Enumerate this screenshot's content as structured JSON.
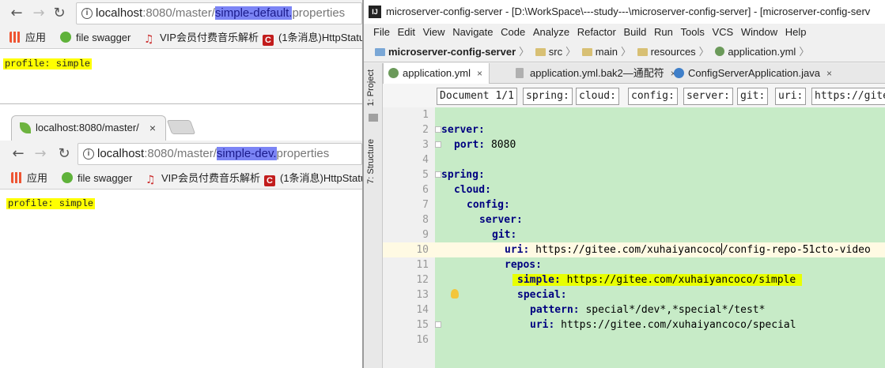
{
  "browser1": {
    "url_host": "localhost",
    "url_port_path": ":8080/master/",
    "url_selected": "simple-default.",
    "url_rest": "properties",
    "bookmarks": [
      "应用",
      "file swagger",
      "VIP会员付费音乐解析",
      "(1条消息)HttpStatu"
    ],
    "content": "profile: simple"
  },
  "browser2": {
    "tab_title": "localhost:8080/master/",
    "tab_close": "×",
    "url_host": "localhost",
    "url_port_path": ":8080/master/",
    "url_selected": "simple-dev.",
    "url_rest": "properties",
    "bookmarks": [
      "应用",
      "file swagger",
      "VIP会员付费音乐解析",
      "(1条消息)HttpStatu"
    ],
    "content": "profile: simple"
  },
  "ide": {
    "title": "microserver-config-server - [D:\\WorkSpace\\---study---\\microserver-config-server] - [microserver-config-serv",
    "menu": [
      "File",
      "Edit",
      "View",
      "Navigate",
      "Code",
      "Analyze",
      "Refactor",
      "Build",
      "Run",
      "Tools",
      "VCS",
      "Window",
      "Help"
    ],
    "breadcrumbs": [
      "microserver-config-server",
      "src",
      "main",
      "resources",
      "application.yml"
    ],
    "side_tabs": [
      "1: Project",
      "7: Structure"
    ],
    "file_tabs": [
      {
        "label": "application.yml",
        "close": "×"
      },
      {
        "label": "application.yml.bak2—通配符",
        "close": "×"
      },
      {
        "label": "ConfigServerApplication.java",
        "close": "×"
      }
    ],
    "yaml_path": [
      "Document 1/1",
      "spring:",
      "cloud:",
      "config:",
      "server:",
      "git:",
      "uri:",
      "https://gite"
    ],
    "lines": [
      "1",
      "2",
      "3",
      "4",
      "5",
      "6",
      "7",
      "8",
      "9",
      "10",
      "11",
      "12",
      "13",
      "14",
      "15",
      "16"
    ],
    "code": {
      "l2": "server:",
      "l3k": "port:",
      "l3v": " 8080",
      "l5": "spring:",
      "l6": "cloud:",
      "l7": "config:",
      "l8": "server:",
      "l9": "git:",
      "l10k": "uri:",
      "l10v1": " https://gitee.com/xuhaiyancoco",
      "l10v2": "/config-repo-51cto-video",
      "l11": "repos:",
      "l12k": "simple:",
      "l12v": " https://gitee.com/xuhaiyancoco/simple ",
      "l13": "special:",
      "l14k": "pattern:",
      "l14v": " special*/dev*,*special*/test*",
      "l15k": "uri:",
      "l15v": " https://gitee.com/xuhaiyancoco/special"
    }
  }
}
